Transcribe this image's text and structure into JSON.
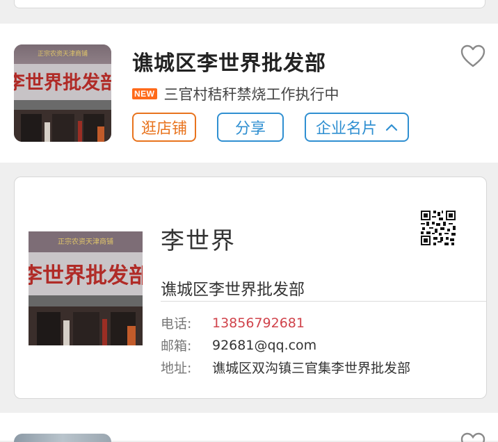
{
  "shop": {
    "title": "谯城区李世界批发部",
    "new_badge": "NEW",
    "notice": "三官村秸秆禁烧工作执行中",
    "buttons": {
      "visit_shop": "逛店铺",
      "share": "分享",
      "business_card": "企业名片"
    },
    "storefront_sign": "李世界批发部"
  },
  "business_card": {
    "name": "李世界",
    "company": "谯城区李世界批发部",
    "phone_label": "电话:",
    "phone": "13856792681",
    "email_label": "邮箱:",
    "email": "92681@qq.com",
    "address_label": "地址:",
    "address": "谯城区双沟镇三官集李世界批发部"
  },
  "colors": {
    "accent_orange": "#e8731d",
    "accent_blue": "#2f8fd1",
    "phone_red": "#d0434b",
    "new_badge": "#ff6a1a"
  },
  "icons": {
    "favorite": "heart-outline-icon",
    "expand": "chevron-up-icon",
    "qr": "qr-code-icon"
  }
}
